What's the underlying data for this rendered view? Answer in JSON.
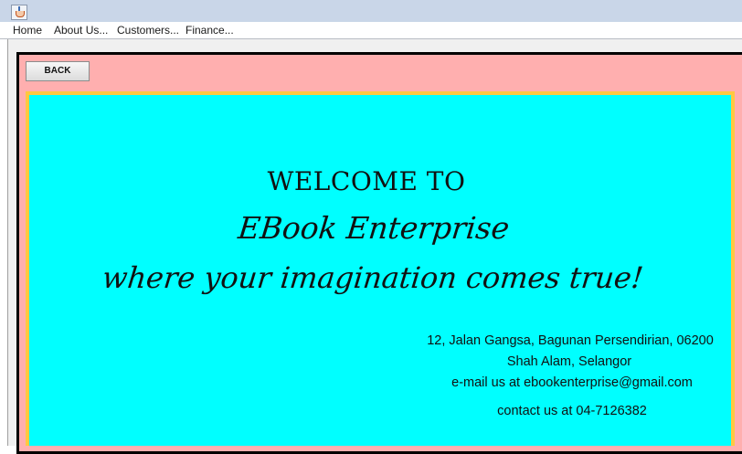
{
  "titlebar": {
    "icon": "java-cup-icon"
  },
  "menu": {
    "home": "Home",
    "about": "About Us...",
    "customers": "Customers...",
    "finance": "Finance..."
  },
  "back_button": "BACK",
  "welcome": {
    "line1": "WELCOME TO",
    "brand": "EBook Enterprise",
    "tagline": "where your imagination comes true!"
  },
  "contact": {
    "address_line1": "12, Jalan Gangsa, Bagunan Persendirian, 06200",
    "address_line2": "Shah Alam, Selangor",
    "email": "e-mail us at ebookenterprise@gmail.com",
    "phone": "contact us at 04-7126382"
  },
  "colors": {
    "outer_panel": "#ffafaf",
    "inner_panel": "#00ffff",
    "inner_border": "#ffc840",
    "outer_border": "#000000"
  }
}
